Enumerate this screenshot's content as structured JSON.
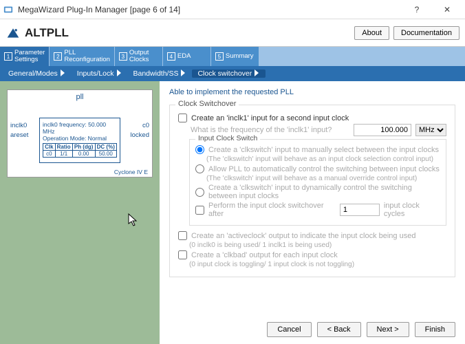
{
  "window": {
    "title": "MegaWizard Plug-In Manager [page 6 of 14]"
  },
  "brand": "ALTPLL",
  "header_buttons": {
    "about": "About",
    "docs": "Documentation"
  },
  "steps": [
    {
      "num": "1",
      "label": "Parameter\nSettings"
    },
    {
      "num": "2",
      "label": "PLL\nReconfiguration"
    },
    {
      "num": "3",
      "label": "Output\nClocks"
    },
    {
      "num": "4",
      "label": "EDA"
    },
    {
      "num": "5",
      "label": "Summary"
    }
  ],
  "subtabs": [
    "General/Modes",
    "Inputs/Lock",
    "Bandwidth/SS",
    "Clock switchover"
  ],
  "diagram": {
    "title": "pll",
    "pins": {
      "inclk0": "inclk0",
      "areset": "areset",
      "c0": "c0",
      "locked": "locked"
    },
    "freq_line": "inclk0 frequency: 50.000 MHz",
    "mode_line": "Operation Mode: Normal",
    "table": {
      "headers": [
        "Clk",
        "Ratio",
        "Ph (dg)",
        "DC (%)"
      ],
      "row": [
        "c0",
        "1/1",
        "0.00",
        "50.00"
      ]
    },
    "device": "Cyclone IV E"
  },
  "able_line": "Able to implement the requested PLL",
  "group_title": "Clock Switchover",
  "opts": {
    "create_inclk1": "Create an 'inclk1' input for a second input clock",
    "freq_q": "What is the frequency of the 'inclk1' input?",
    "freq_val": "100.000",
    "freq_unit": "MHz",
    "ics_title": "Input Clock Switch",
    "r1": "Create a 'clkswitch' input to manually select between the input clocks",
    "r1sub": "(The 'clkswitch' input will behave as an input clock selection control input)",
    "r2": "Allow PLL to automatically control the switching between input clocks",
    "r2sub": "(The 'clkswitch' input will behave as a manual override control input)",
    "r3": "Create a 'clkswitch' input to dynamically control the switching between input clocks",
    "chk_perform": "Perform the input clock switchover after",
    "cycles_val": "1",
    "cycles_tail": "input clock cycles",
    "chk_active": "Create an 'activeclock' output to indicate the input clock being used",
    "active_sub": "(0 inclk0 is being used/ 1 inclk1 is being used)",
    "chk_clkbad": "Create a 'clkbad' output for each input clock",
    "clkbad_sub": "(0 input clock is toggling/ 1 input clock is not toggling)"
  },
  "footer": {
    "cancel": "Cancel",
    "back": "< Back",
    "next": "Next >",
    "finish": "Finish"
  }
}
